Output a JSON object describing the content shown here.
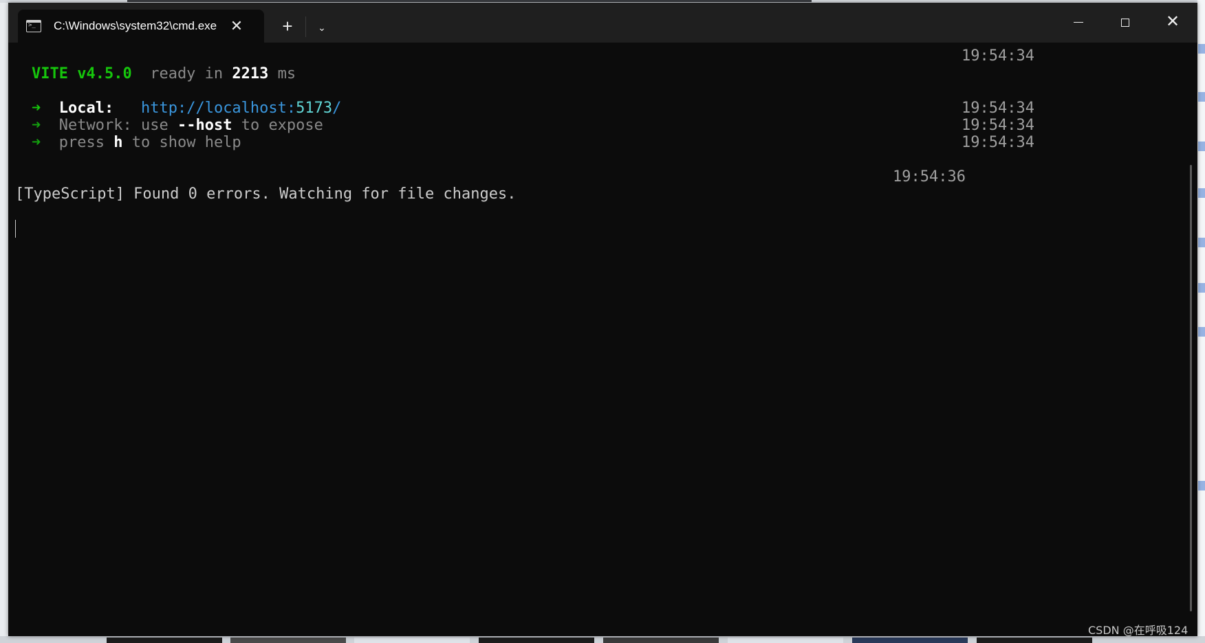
{
  "window": {
    "tab_title": "C:\\Windows\\system32\\cmd.exe",
    "tab_close_glyph": "✕",
    "new_tab_glyph": "+",
    "dropdown_glyph": "⌄",
    "close_glyph": "✕"
  },
  "console": {
    "vite_name": "VITE v4.5.0",
    "ready_text": "ready in",
    "ready_ms": "2213",
    "ready_unit": "ms",
    "arrow": "➜",
    "local_label": "Local:",
    "local_url_base": "http://localhost:",
    "local_url_port": "5173",
    "local_url_slash": "/",
    "network_label": "Network:",
    "network_pre": "use",
    "network_flag": "--host",
    "network_post": "to expose",
    "help_pre": "press",
    "help_key": "h",
    "help_post": "to show help",
    "ts_1": "19:54:34",
    "ts_2": "19:54:34",
    "ts_3": "19:54:34",
    "ts_4": "19:54:34",
    "ts_5": "19:54:36",
    "typescript_line": "[TypeScript] Found 0 errors. Watching for file changes."
  },
  "watermark": "CSDN @在呼吸124",
  "colors": {
    "background": "#0c0c0c",
    "titlebar": "#1f1f1f",
    "vite_green": "#16c60c",
    "url_blue": "#3a96dd",
    "url_port": "#61d6d6"
  }
}
